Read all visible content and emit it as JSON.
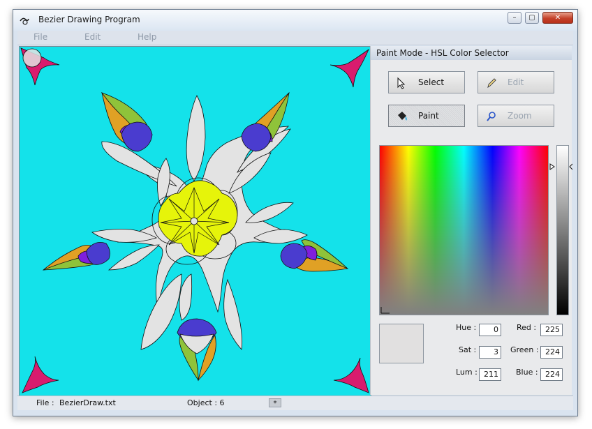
{
  "window": {
    "title": "Bezier Drawing Program",
    "min_glyph": "–",
    "max_glyph": "▢",
    "close_glyph": "✕"
  },
  "menu": {
    "file": "File",
    "edit": "Edit",
    "help": "Help"
  },
  "panel": {
    "header": "Paint Mode - HSL Color Selector",
    "buttons": {
      "select": "Select",
      "edit": "Edit",
      "paint": "Paint",
      "zoom": "Zoom"
    }
  },
  "hsl": {
    "hue_label": "Hue :",
    "hue": "0",
    "sat_label": "Sat :",
    "sat": "3",
    "lum_label": "Lum :",
    "lum": "211",
    "red_label": "Red :",
    "red": "225",
    "green_label": "Green :",
    "green": "224",
    "blue_label": "Blue :",
    "blue": "224",
    "swatch_color": "#e1e0e0"
  },
  "status": {
    "file_label": "File  :",
    "file_name": "BezierDraw.txt",
    "object": "Object : 6",
    "star": "*"
  },
  "colors": {
    "canvas_bg": "#14e2ea",
    "petal_gray": "#e3e3e3",
    "blue": "#4a3ccf",
    "orange": "#e0a125",
    "green": "#8fc33a",
    "purple": "#7f1fdc",
    "yellow": "#e6f40a",
    "magenta": "#d81c6e"
  }
}
